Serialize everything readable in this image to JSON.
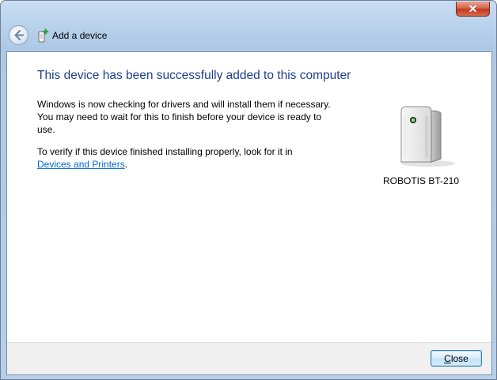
{
  "window": {
    "close_glyph": "✕"
  },
  "header": {
    "back_icon": "back-arrow-icon",
    "wizard_icon": "add-device-icon",
    "title": "Add a device"
  },
  "content": {
    "heading": "This device has been successfully added to this computer",
    "paragraph1": "Windows is now checking for drivers and will install them if necessary. You may need to wait for this to finish before your device is ready to use.",
    "paragraph2_prefix": "To verify if this device finished installing properly, look for it in",
    "paragraph2_link": "Devices and Printers",
    "paragraph2_suffix": "."
  },
  "device": {
    "icon": "bluetooth-device-icon",
    "name": "ROBOTIS BT-210"
  },
  "footer": {
    "close_label_first": "C",
    "close_label_rest": "lose"
  },
  "colors": {
    "heading": "#1e3f8e",
    "link": "#0066cc",
    "close_button_red": "#c0391f",
    "footer_bg": "#f0f0f0"
  }
}
